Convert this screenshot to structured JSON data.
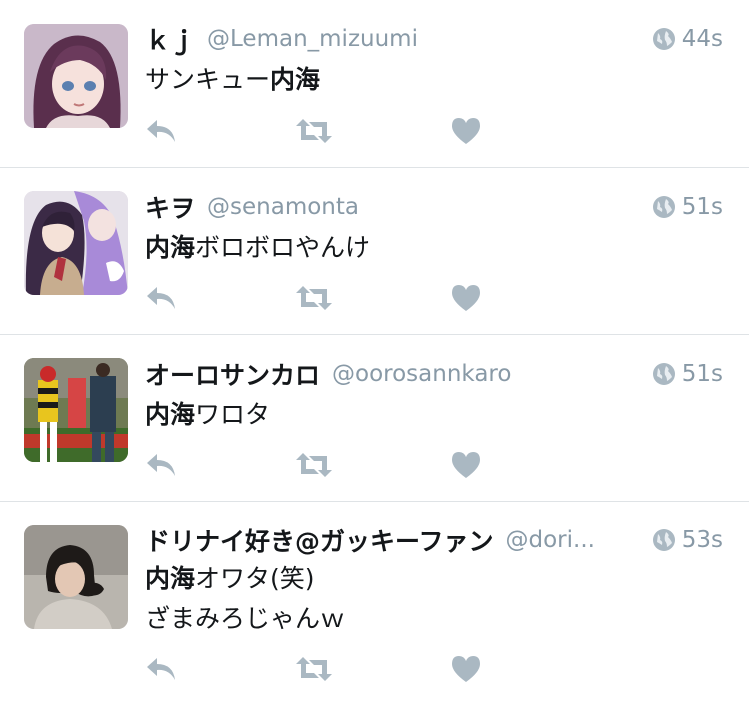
{
  "tweets": [
    {
      "name": "ｋｊ",
      "handle": "@Leman_mizuumi",
      "time": "44s",
      "lines": [
        {
          "bold": "",
          "rest": "サンキュー",
          "tail_bold": "内海"
        }
      ],
      "avatar": "purple-haired-anime-girl"
    },
    {
      "name": "キヲ",
      "handle": "@senamonta",
      "time": "51s",
      "lines": [
        {
          "bold": "内海",
          "rest": "ボロボロやんけ",
          "tail_bold": ""
        }
      ],
      "avatar": "anime-pair"
    },
    {
      "name": "オーロサンカロ",
      "handle": "@oorosannkaro",
      "time": "51s",
      "lines": [
        {
          "bold": "内海",
          "rest": "ワロタ",
          "tail_bold": ""
        }
      ],
      "avatar": "jockey-photo"
    },
    {
      "name": "ドリナイ好き@ガッキーファン",
      "handle": "@dori...",
      "time": "53s",
      "lines": [
        {
          "bold": "内海",
          "rest": "オワタ(笑)",
          "tail_bold": ""
        },
        {
          "bold": "",
          "rest": "ざまみろじゃんｗ",
          "tail_bold": ""
        }
      ],
      "avatar": "woman-photo"
    }
  ],
  "icons": {
    "reply": "reply-icon",
    "retweet": "retweet-icon",
    "like": "heart-icon",
    "visibility": "globe-icon"
  },
  "colors": {
    "muted": "#8899a6",
    "icon": "#aab8c2",
    "text": "#14171a",
    "divider": "#dfe3e6"
  }
}
